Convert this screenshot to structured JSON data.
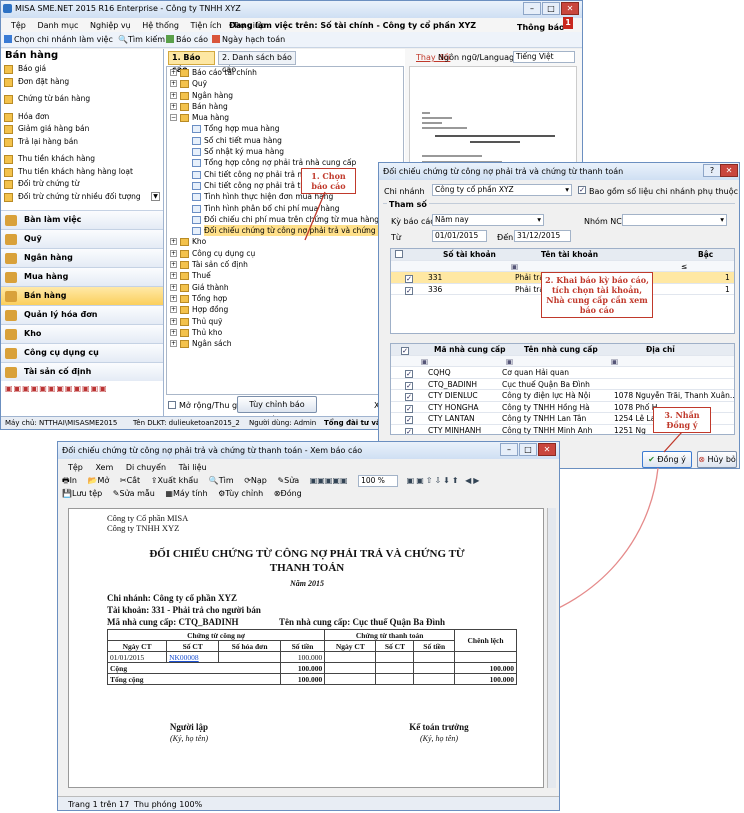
{
  "main": {
    "title": "MISA SME.NET 2015 R16 Enterprise - Công ty TNHH XYZ",
    "menu": [
      "Tệp",
      "Danh mục",
      "Nghiệp vụ",
      "Hệ thống",
      "Tiện ích",
      "Trợ giúp"
    ],
    "db_info": "Đang làm việc trên: Số tài chính - Công ty cổ phần XYZ",
    "notify": "Thông báo",
    "notify_count": "1",
    "toolbar": [
      "Chọn chi nhánh làm việc",
      "Tìm kiếm",
      "Báo cáo",
      "Ngày hạch toán"
    ],
    "left_title": "Bán hàng",
    "left_items": [
      "Báo giá",
      "Đơn đặt hàng",
      "Chứng từ bán hàng",
      "Hóa đơn",
      "Giảm giá hàng bán",
      "Trả lại hàng bán",
      "Thu tiền khách hàng",
      "Thu tiền khách hàng hàng loạt",
      "Đối trừ chứng từ",
      "Đối trừ chứng từ nhiều đối tượng"
    ],
    "modules": [
      "Bàn làm việc",
      "Quỹ",
      "Ngân hàng",
      "Mua hàng",
      "Bán hàng",
      "Quản lý hóa đơn",
      "Kho",
      "Công cụ dụng cụ",
      "Tài sản cố định"
    ],
    "tab_report": "1. Báo cáo",
    "tab_list": "2. Danh sách báo cáo",
    "tree": [
      "Báo cáo tài chính",
      "Quỹ",
      "Ngân hàng",
      "Bán hàng",
      "Mua hàng",
      "Tổng hợp mua hàng",
      "Sổ chi tiết mua hàng",
      "Sổ nhật ký mua hàng",
      "Tổng hợp công nợ phải trả nhà cung cấp",
      "Chi tiết công nợ phải trả nhà cung cấp",
      "Chi tiết công nợ phải trả theo hóa đơn",
      "Tình hình thực hiện đơn mua hàng",
      "Tình hình phân bổ chi phí mua hàng",
      "Đối chiếu chi phí mua trên chứng từ mua hàng và chứng từ",
      "Đối chiếu chứng từ công nợ phải trả và chứng từ thanh toán",
      "Kho",
      "Công cụ dụng cụ",
      "Tài sản cố định",
      "Thuế",
      "Giá thành",
      "Tổng hợp",
      "Hợp đồng",
      "Thủ quỹ",
      "Thủ kho",
      "Ngân sách"
    ],
    "expand_label": "Mở rộng/Thu gọn",
    "custom_btn": "Tùy chỉnh báo cáo...",
    "view_btn": "Xem",
    "lang_change": "Thay đổi",
    "lang_label": "Ngôn ngữ/Language",
    "lang_value": "Tiếng Việt",
    "status": [
      "Máy chủ: NTTHAI\\MISASME2015",
      "Tên DLKT: dulieuketoan2015_2",
      "Người dùng: Admin",
      "Tổng đài tư vấn:"
    ]
  },
  "dialog": {
    "title": "Đối chiếu chứng từ công nợ phải trả và chứng từ thanh toán",
    "branch_label": "Chi nhánh",
    "branch_value": "Công ty cổ phần XYZ",
    "include_sub": "Bao gồm số liệu chi nhánh phụ thuộc",
    "params_label": "Tham số",
    "period_label": "Kỳ báo cáo",
    "period_value": "Năm nay",
    "supplier_group_label": "Nhóm NCC",
    "from_label": "Từ",
    "from_value": "01/01/2015",
    "to_label": "Đến",
    "to_value": "31/12/2015",
    "acc_headers": [
      "Số tài khoản",
      "Tên tài khoản",
      "Bậc"
    ],
    "accounts": [
      {
        "no": "331",
        "name": "Phải trả c",
        "level": "1"
      },
      {
        "no": "336",
        "name": "Phải trả n",
        "level": "1"
      }
    ],
    "sup_headers": [
      "Mã nhà cung cấp",
      "Tên nhà cung cấp",
      "Địa chỉ"
    ],
    "suppliers": [
      {
        "code": "CQHQ",
        "name": "Cơ quan Hải quan",
        "addr": ""
      },
      {
        "code": "CTQ_BADINH",
        "name": "Cục thuế Quận Ba Đình",
        "addr": ""
      },
      {
        "code": "CTY DIENLUC",
        "name": "Công ty điện lực Hà Nội",
        "addr": "1078 Nguyễn Trãi, Thanh Xuân..."
      },
      {
        "code": "CTY HONGHA",
        "name": "Công ty TNHH Hồng Hà",
        "addr": "1078 Phố H"
      },
      {
        "code": "CTY LANTAN",
        "name": "Công ty TNHH Lan Tân",
        "addr": "1254 Lê La"
      },
      {
        "code": "CTY MINHANH",
        "name": "Công ty TNHH Minh Anh",
        "addr": "1251 Ng"
      }
    ],
    "ok": "Đồng ý",
    "help": "Hủy bỏ"
  },
  "callouts": {
    "c1": "1. Chọn báo cáo",
    "c2": "2. Khai báo kỳ báo cáo, tích chọn tài khoản, Nhà cung cấp cần xem báo cáo",
    "c3": "3. Nhấn Đồng ý"
  },
  "preview": {
    "title": "Đối chiếu chứng từ công nợ phải trả và chứng từ thanh toán - Xem báo cáo",
    "menu": [
      "Tệp",
      "Xem",
      "Di chuyển",
      "Tài liệu"
    ],
    "tools": [
      "In",
      "Mở",
      "Cắt",
      "Xuất khẩu",
      "Tìm",
      "Nạp",
      "Sửa",
      "100 %"
    ],
    "tools2": [
      "Lưu tệp",
      "Sửa mẫu",
      "Máy tính",
      "Tùy chỉnh",
      "Đóng"
    ],
    "company1": "Công ty Cổ phần MISA",
    "company2": "Công ty TNHH XYZ",
    "heading1": "ĐỐI CHIẾU CHỨNG TỪ CÔNG NỢ PHẢI TRẢ VÀ CHỨNG TỪ",
    "heading2": "THANH TOÁN",
    "year": "Năm 2015",
    "branch": "Chi nhánh:  Công ty cổ phần XYZ",
    "account": "Tài khoản:  331 - Phải trả cho người bán",
    "sup_code": "Mã nhà cung cấp:  CTQ_BADINH",
    "sup_name": "Tên nhà cung cấp:  Cục thuế Quận Ba Đình",
    "h_debt": "Chứng từ công nợ",
    "h_pay": "Chứng từ thanh toán",
    "h_diff": "Chênh lệch",
    "cols": [
      "Ngày CT",
      "Số CT",
      "Số hóa đơn",
      "Số tiền",
      "Ngày CT",
      "Số CT",
      "Số tiền"
    ],
    "row": {
      "date": "01/01/2015",
      "no": "NK00008",
      "amount": "100.000"
    },
    "sum_label": "Cộng",
    "sum_amount": "100.000",
    "sum_diff": "100.000",
    "total_label": "Tổng cộng",
    "total_amount": "100.000",
    "total_diff": "100.000",
    "sign1": "Người lập",
    "sign1b": "(Ký, họ tên)",
    "sign2": "Kế toán trưởng",
    "sign2b": "(Ký, họ tên)",
    "page": "Trang 1 trên 17",
    "zoom": "Thu phóng 100%"
  }
}
